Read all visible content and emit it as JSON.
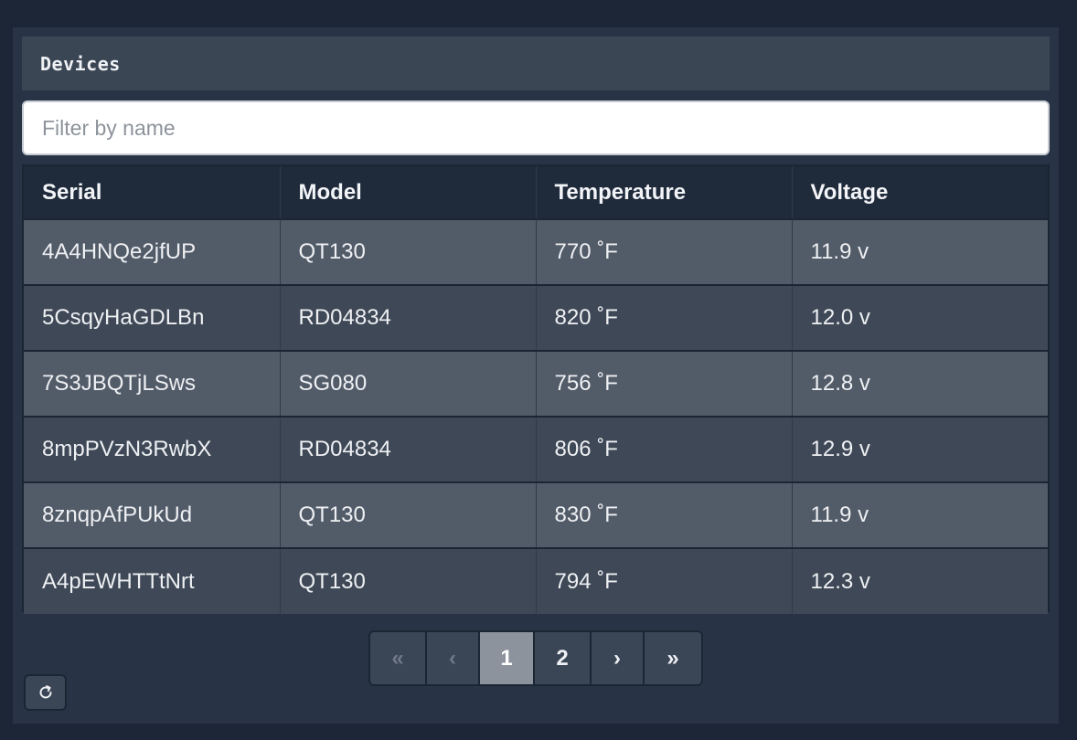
{
  "panel": {
    "title": "Devices"
  },
  "filter": {
    "placeholder": "Filter by name",
    "value": ""
  },
  "table": {
    "columns": [
      "Serial",
      "Model",
      "Temperature",
      "Voltage"
    ],
    "rows": [
      [
        "4A4HNQe2jfUP",
        "QT130",
        "770 ˚F",
        "11.9 v"
      ],
      [
        "5CsqyHaGDLBn",
        "RD04834",
        "820 ˚F",
        "12.0 v"
      ],
      [
        "7S3JBQTjLSws",
        "SG080",
        "756 ˚F",
        "12.8 v"
      ],
      [
        "8mpPVzN3RwbX",
        "RD04834",
        "806 ˚F",
        "12.9 v"
      ],
      [
        "8znqpAfPUkUd",
        "QT130",
        "830 ˚F",
        "11.9 v"
      ],
      [
        "A4pEWHTTtNrt",
        "QT130",
        "794 ˚F",
        "12.3 v"
      ]
    ]
  },
  "pagination": {
    "first": "«",
    "prev": "‹",
    "pages": [
      "1",
      "2"
    ],
    "current_page": "1",
    "next": "›",
    "last": "»"
  },
  "icons": {
    "refresh": "refresh-icon"
  }
}
